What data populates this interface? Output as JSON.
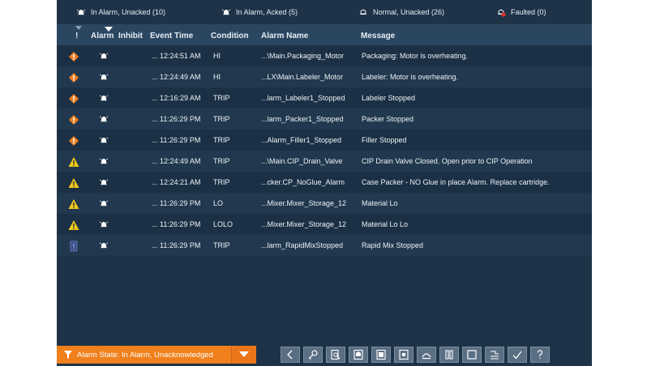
{
  "summary": {
    "in_alarm_unacked": "In Alarm, Unacked (10)",
    "in_alarm_acked": "In Alarm, Acked (5)",
    "normal_unacked": "Normal, Unacked (26)",
    "faulted": "Faulted (0)"
  },
  "columns": {
    "severity": "!",
    "alarm": "Alarm",
    "inhibit": "Inhibit",
    "event_time": "Event Time",
    "condition": "Condition",
    "alarm_name": "Alarm Name",
    "message": "Message"
  },
  "rows": [
    {
      "severity": "critical",
      "time": "... 12:24:51 AM",
      "condition": "HI",
      "name": "...\\Main.Packaging_Motor",
      "message": "Packaging: Motor is overheating."
    },
    {
      "severity": "critical",
      "time": "... 12:24:49 AM",
      "condition": "HI",
      "name": "...LX\\Main.Labeler_Motor",
      "message": "Labeler: Motor is overheating."
    },
    {
      "severity": "critical",
      "time": "... 12:16:29 AM",
      "condition": "TRIP",
      "name": "...larm_Labeler1_Stopped",
      "message": "Labeler Stopped"
    },
    {
      "severity": "critical",
      "time": "... 11:26:29 PM",
      "condition": "TRIP",
      "name": "...larm_Packer1_Stopped",
      "message": "Packer Stopped"
    },
    {
      "severity": "critical",
      "time": "... 11:26:29 PM",
      "condition": "TRIP",
      "name": "...Alarm_Filler1_Stopped",
      "message": "Filler Stopped"
    },
    {
      "severity": "warning",
      "time": "... 12:24:49 AM",
      "condition": "TRIP",
      "name": "...\\Main.CIP_Drain_Valve",
      "message": "CIP Drain Valve Closed.  Open prior to CIP Operation"
    },
    {
      "severity": "warning",
      "time": "... 12:24:21 AM",
      "condition": "TRIP",
      "name": "...cker.CP_NoGlue_Alarm",
      "message": "Case Packer - NO Glue in place Alarm. Replace cartridge."
    },
    {
      "severity": "warning",
      "time": "... 11:26:29 PM",
      "condition": "LO",
      "name": "...Mixer.Mixer_Storage_12",
      "message": "Material Lo"
    },
    {
      "severity": "warning",
      "time": "... 11:26:29 PM",
      "condition": "LOLO",
      "name": "...Mixer.Mixer_Storage_12",
      "message": "Material Lo Lo"
    },
    {
      "severity": "info",
      "time": "... 11:26:29 PM",
      "condition": "TRIP",
      "name": "...larm_RapidMixStopped",
      "message": "Rapid Mix Stopped"
    }
  ],
  "filter": {
    "label": "Alarm State: In Alarm, Unacknowledged",
    "icon": "funnel-icon"
  },
  "toolbar": {
    "buttons": [
      "back-icon",
      "key-icon",
      "find-icon",
      "ack-page-icon",
      "ack-all-icon",
      "reset-icon",
      "shelve-icon",
      "suspend-icon",
      "stop-icon",
      "layout-icon",
      "check-icon",
      "help-icon"
    ]
  },
  "colors": {
    "background": "#1e3348",
    "header": "#2b4661",
    "row_odd": "#1b3045",
    "row_even": "#21384e",
    "critical": "#f07d1e",
    "warning": "#f2c919",
    "accent": "#f0801c"
  }
}
